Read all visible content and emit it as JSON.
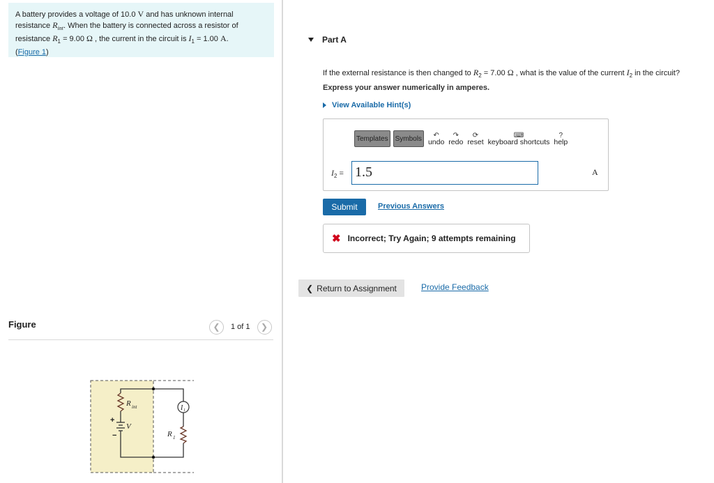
{
  "problem": {
    "text_1": "A battery provides a voltage of 10.0",
    "unit_v": "V",
    "text_2": "and has unknown internal",
    "text_3": "resistance",
    "var_rint": "R",
    "sub_int": "int",
    "text_4": ". When the battery is connected across a resistor of",
    "text_5": "resistance",
    "var_r1": "R",
    "sub_1": "1",
    "text_6": "= 9.00",
    "unit_ohm": "Ω",
    "text_7": ", the current in the circuit is",
    "var_i1": "I",
    "sub_i1": "1",
    "text_8": "= 1.00",
    "unit_a": "A",
    "text_9": ".",
    "link_open": "(",
    "figure_link": "Figure 1",
    "link_close": ")"
  },
  "figure": {
    "label": "Figure",
    "count": "1 of 1",
    "prev_icon": "chevron-left-icon",
    "next_icon": "chevron-right-icon",
    "circuit_labels": {
      "rint": "R",
      "rint_sub": "int",
      "v": "V",
      "r1": "R",
      "r1_sub": "1",
      "i1": "I",
      "i1_sub": "1",
      "plus": "+",
      "minus": "−"
    }
  },
  "part": {
    "title": "Part A",
    "question_1": "If the external resistance is then changed to",
    "var_r2": "R",
    "sub_2": "2",
    "question_2": "= 7.00",
    "unit_ohm": "Ω",
    "question_3": ", what is the value of the current",
    "var_i2": "I",
    "sub_i2": "2",
    "question_4": "in the circuit?",
    "express": "Express your answer numerically in amperes.",
    "hints": "View Available Hint(s)"
  },
  "answer": {
    "toolbar": {
      "templates": "Templates",
      "symbols": "Symbols",
      "undo": "undo",
      "redo": "redo",
      "reset": "reset",
      "keyboard": "keyboard shortcuts",
      "help": "help"
    },
    "label_var": "I",
    "label_sub": "2",
    "label_eq": "=",
    "value": "1.5",
    "unit": "A"
  },
  "actions": {
    "submit": "Submit",
    "previous_answers": "Previous Answers",
    "return": "Return to Assignment",
    "provide_feedback": "Provide Feedback"
  },
  "feedback": {
    "icon": "x-icon",
    "text": "Incorrect; Try Again; 9 attempts remaining"
  },
  "colors": {
    "accent": "#1a6ba8",
    "problem_bg": "#e6f6f8",
    "error": "#d0021b",
    "figure_bg": "#f5efc8"
  }
}
